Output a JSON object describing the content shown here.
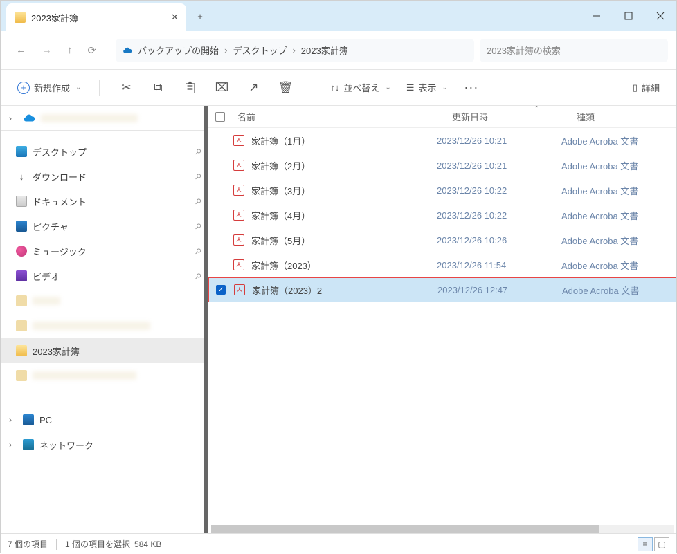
{
  "window": {
    "tab_title": "2023家計簿",
    "new_tab_symbol": "+",
    "close_symbol": "✕",
    "minimize": "—"
  },
  "nav": {
    "back": "←",
    "forward": "→",
    "up": "↑",
    "refresh": "⟳"
  },
  "breadcrumb": {
    "backup_label": "バックアップの開始",
    "items": [
      "デスクトップ",
      "2023家計簿"
    ]
  },
  "search": {
    "placeholder": "2023家計簿の検索"
  },
  "toolbar": {
    "new_label": "新規作成",
    "sort_label": "並べ替え",
    "view_label": "表示",
    "details_label": "詳細"
  },
  "sidebar": {
    "quick_items": [
      {
        "label": "デスクトップ",
        "icon": "desktop"
      },
      {
        "label": "ダウンロード",
        "icon": "download"
      },
      {
        "label": "ドキュメント",
        "icon": "document"
      },
      {
        "label": "ピクチャ",
        "icon": "picture"
      },
      {
        "label": "ミュージック",
        "icon": "music"
      },
      {
        "label": "ビデオ",
        "icon": "video"
      }
    ],
    "current_folder": "2023家計簿",
    "pc_label": "PC",
    "network_label": "ネットワーク"
  },
  "columns": {
    "name": "名前",
    "date": "更新日時",
    "type": "種類"
  },
  "files": [
    {
      "name": "家計簿（1月）",
      "date": "2023/12/26 10:21",
      "type": "Adobe Acroba 文書",
      "selected": false
    },
    {
      "name": "家計簿（2月）",
      "date": "2023/12/26 10:21",
      "type": "Adobe Acroba 文書",
      "selected": false
    },
    {
      "name": "家計簿（3月）",
      "date": "2023/12/26 10:22",
      "type": "Adobe Acroba 文書",
      "selected": false
    },
    {
      "name": "家計簿（4月）",
      "date": "2023/12/26 10:22",
      "type": "Adobe Acroba 文書",
      "selected": false
    },
    {
      "name": "家計簿（5月）",
      "date": "2023/12/26 10:26",
      "type": "Adobe Acroba 文書",
      "selected": false
    },
    {
      "name": "家計簿（2023）",
      "date": "2023/12/26 11:54",
      "type": "Adobe Acroba 文書",
      "selected": false
    },
    {
      "name": "家計簿（2023）2",
      "date": "2023/12/26 12:47",
      "type": "Adobe Acroba 文書",
      "selected": true
    }
  ],
  "status": {
    "item_count": "7 個の項目",
    "selection": "1 個の項目を選択",
    "size": "584 KB"
  }
}
